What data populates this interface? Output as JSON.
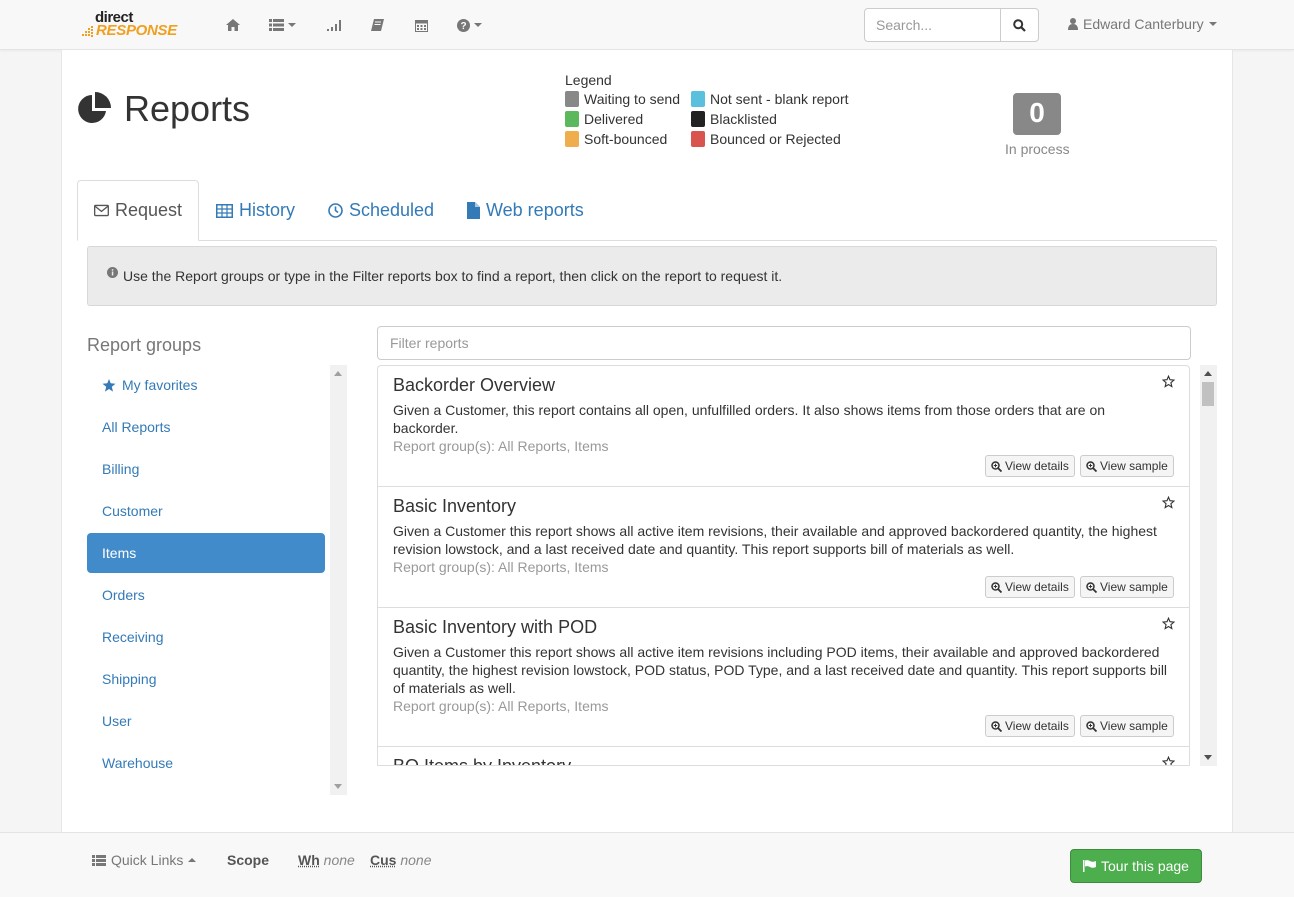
{
  "navbar": {
    "logo_line1": "direct",
    "logo_line2": "RESPONSE",
    "icons": [
      "home-icon",
      "list-icon",
      "signal-icon",
      "book-icon",
      "calendar-icon",
      "help-icon"
    ],
    "search_placeholder": "Search...",
    "user_name": "Edward Canterbury"
  },
  "page": {
    "title": "Reports"
  },
  "legend": {
    "title": "Legend",
    "items": [
      {
        "label": "Waiting to send",
        "color": "#888888"
      },
      {
        "label": "Not sent - blank report",
        "color": "#5bc0de"
      },
      {
        "label": "Delivered",
        "color": "#5cb85c"
      },
      {
        "label": "Blacklisted",
        "color": "#222222"
      },
      {
        "label": "Soft-bounced",
        "color": "#f0ad4e"
      },
      {
        "label": "Bounced or Rejected",
        "color": "#d9534f"
      }
    ]
  },
  "counter": {
    "value": "0",
    "label": "In process"
  },
  "tabs": [
    {
      "label": "Request",
      "active": true
    },
    {
      "label": "History",
      "active": false
    },
    {
      "label": "Scheduled",
      "active": false
    },
    {
      "label": "Web reports",
      "active": false
    }
  ],
  "alert": {
    "text": "Use the Report groups or type in the Filter reports box to find a report, then click on the report to request it."
  },
  "groups": {
    "title": "Report groups",
    "items": [
      {
        "label": "My favorites"
      },
      {
        "label": "All Reports"
      },
      {
        "label": "Billing"
      },
      {
        "label": "Customer"
      },
      {
        "label": "Items",
        "active": true
      },
      {
        "label": "Orders"
      },
      {
        "label": "Receiving"
      },
      {
        "label": "Shipping"
      },
      {
        "label": "User"
      },
      {
        "label": "Warehouse"
      }
    ]
  },
  "filter": {
    "placeholder": "Filter reports"
  },
  "reports": [
    {
      "title": "Backorder Overview",
      "description": "Given a Customer, this report contains all open, unfulfilled orders. It also shows items from those orders that are on backorder.",
      "groups": "Report group(s): All Reports, Items",
      "view_details": "View details",
      "view_sample": "View sample"
    },
    {
      "title": "Basic Inventory",
      "description": "Given a Customer this report shows all active item revisions, their available and approved backordered quantity, the highest revision lowstock, and a last received date and quantity. This report supports bill of materials as well.",
      "groups": "Report group(s): All Reports, Items",
      "view_details": "View details",
      "view_sample": "View sample"
    },
    {
      "title": "Basic Inventory with POD",
      "description": "Given a Customer this report shows all active item revisions including POD items, their available and approved backordered quantity, the highest revision lowstock, POD status, POD Type, and a last received date and quantity. This report supports bill of materials as well.",
      "groups": "Report group(s): All Reports, Items",
      "view_details": "View details",
      "view_sample": "View sample"
    },
    {
      "title": "BO Items by Inventory"
    }
  ],
  "footer": {
    "quick_links": "Quick Links",
    "scope": "Scope",
    "wh_label": "Wh",
    "wh_value": "none",
    "cus_label": "Cus",
    "cus_value": "none",
    "tour_label": "Tour this page"
  }
}
